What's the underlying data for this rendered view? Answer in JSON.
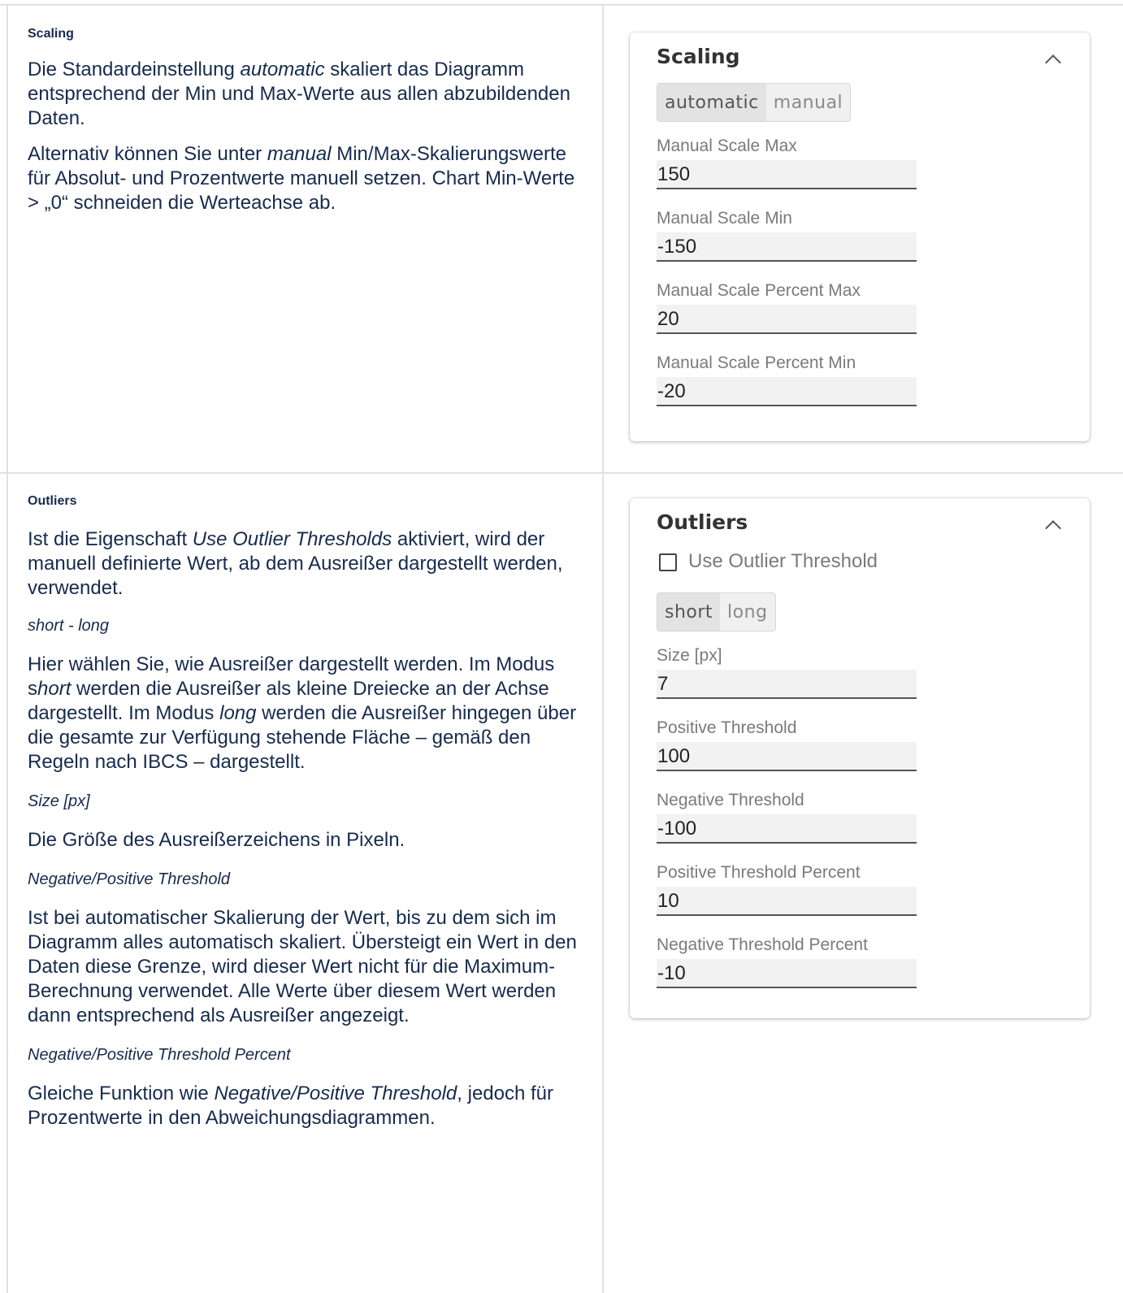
{
  "scaling": {
    "heading": "Scaling",
    "p1_a": "Die Standardeinstellung ",
    "p1_em": "automatic",
    "p1_b": " skaliert das Diagramm entsprechend der Min und Max-Werte aus allen abzubildenden Daten.",
    "p2_a": "Alternativ können Sie unter ",
    "p2_em": "manual",
    "p2_b": " Min/Max-Skalierungswerte für Absolut- und Prozentwerte manuell setzen. Chart Min-Werte > „0“ schneiden die Werteachse ab.",
    "panel": {
      "title": "Scaling",
      "segments": [
        "automatic",
        "manual"
      ],
      "active_segment": "automatic",
      "fields": [
        {
          "label": "Manual Scale Max",
          "value": "150"
        },
        {
          "label": "Manual Scale Min",
          "value": "-150"
        },
        {
          "label": "Manual Scale Percent Max",
          "value": "20"
        },
        {
          "label": "Manual Scale Percent Min",
          "value": "-20"
        }
      ]
    }
  },
  "outliers": {
    "heading": "Outliers",
    "p1_a": "Ist die Eigenschaft ",
    "p1_em": "Use Outlier Thresholds",
    "p1_b": " aktiviert, wird der manuell definierte Wert, ab dem Ausreißer dargestellt werden, verwendet.",
    "sub1": "short - long",
    "p2_a": "Hier wählen Sie, wie Ausreißer dargestellt werden. Im Modus s",
    "p2_em1": "hort",
    "p2_b": " werden die Ausreißer als kleine Dreiecke an der Achse dargestellt. Im Modus ",
    "p2_em2": "long",
    "p2_c": " werden die Ausreißer hingegen über die gesamte zur Verfügung stehende Fläche – gemäß den Regeln nach IBCS – dargestellt.",
    "sub2": "Size [px]",
    "p3": "Die Größe des Ausreißerzeichens in Pixeln.",
    "sub3": "Negative/Positive Threshold",
    "p4": "Ist bei automatischer Skalierung der Wert, bis zu dem sich im Diagramm alles automatisch skaliert. Übersteigt ein Wert in den Daten diese Grenze, wird dieser Wert nicht für die Maximum-Berechnung verwendet. Alle Werte über diesem Wert werden dann entsprechend als Ausreißer angezeigt.",
    "sub4": "Negative/Positive Threshold Percent",
    "p5_a": "Gleiche Funktion wie ",
    "p5_em": "Negative/Positive Threshold",
    "p5_b": ", jedoch für Prozentwerte in den Abweichungsdiagrammen.",
    "panel": {
      "title": "Outliers",
      "checkbox_label": "Use Outlier Threshold",
      "checkbox_checked": false,
      "segments": [
        "short",
        "long"
      ],
      "active_segment": "short",
      "fields": [
        {
          "label": "Size [px]",
          "value": "7"
        },
        {
          "label": "Positive Threshold",
          "value": "100"
        },
        {
          "label": "Negative Threshold",
          "value": "-100"
        },
        {
          "label": "Positive Threshold Percent",
          "value": "10"
        },
        {
          "label": "Negative Threshold Percent",
          "value": "-10"
        }
      ]
    }
  }
}
